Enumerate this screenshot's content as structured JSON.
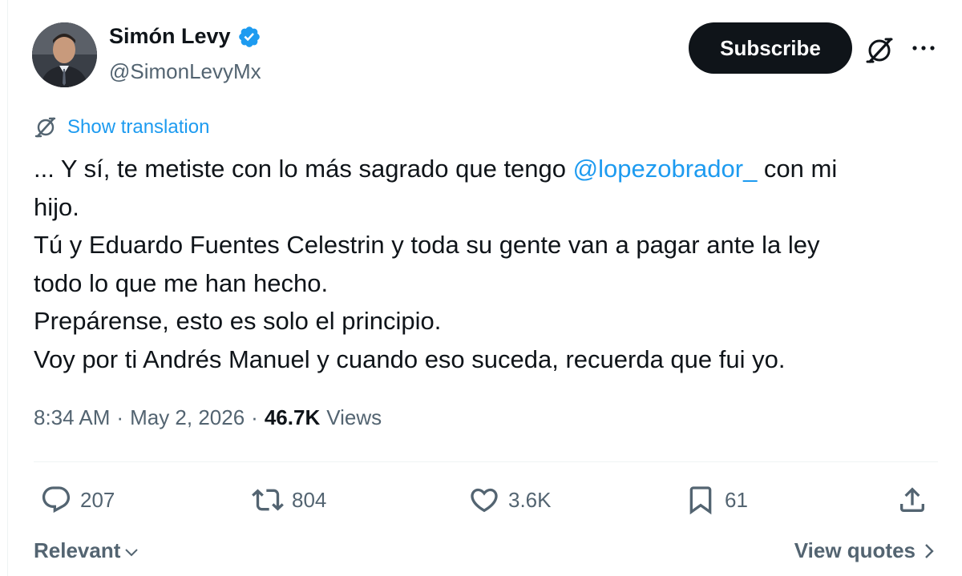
{
  "author": {
    "name": "Simón Levy",
    "handle": "@SimonLevyMx",
    "verified": true
  },
  "header": {
    "subscribe_label": "Subscribe",
    "grok_icon": "grok-icon",
    "more_icon": "more-icon"
  },
  "translation": {
    "label": "Show translation",
    "icon": "translate-icon"
  },
  "tweet": {
    "line1_before": "... Y sí, te metiste con lo más sagrado que tengo ",
    "mention": "@lopezobrador_",
    "line1_after": " con mi",
    "line2": "hijo.",
    "line3": "Tú y Eduardo Fuentes Celestrin y toda su gente van a pagar ante la ley",
    "line4": "todo lo que me han hecho.",
    "line5": "Prepárense, esto es solo el principio.",
    "line6": "Voy por ti Andrés Manuel y cuando eso suceda, recuerda que fui yo."
  },
  "meta": {
    "time": "8:34 AM",
    "sep1": "·",
    "date": "May 2, 2026",
    "sep2": "·",
    "views_count": "46.7K",
    "views_label": "Views"
  },
  "actions": {
    "replies": "207",
    "reposts": "804",
    "likes": "3.6K",
    "bookmarks": "61"
  },
  "footer": {
    "sort_label": "Relevant",
    "view_quotes_label": "View quotes"
  },
  "colors": {
    "accent": "#1d9bf0",
    "text": "#0f1419",
    "muted": "#536471",
    "button_bg": "#0f1419"
  }
}
